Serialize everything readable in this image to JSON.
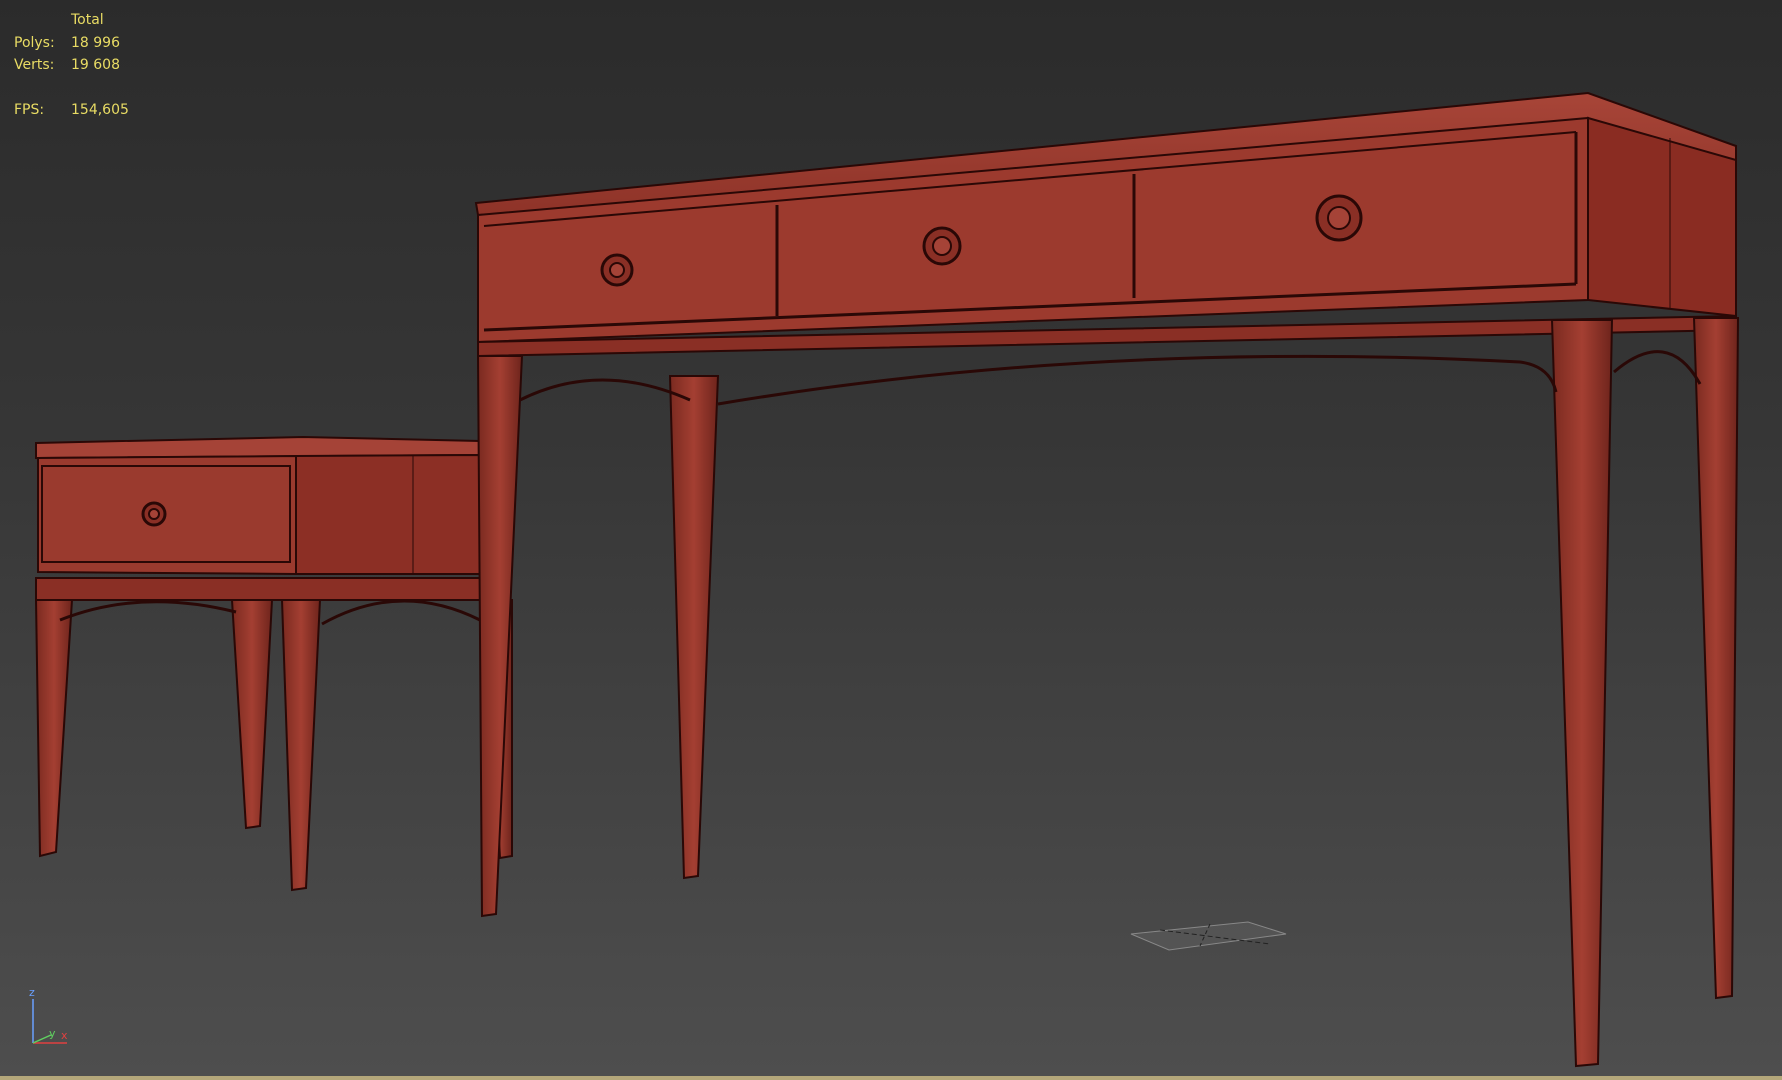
{
  "stats": {
    "header": "Total",
    "rows": [
      {
        "label": "Polys:",
        "value": "18 996"
      },
      {
        "label": "Verts:",
        "value": "19 608"
      }
    ],
    "fps": {
      "label": "FPS:",
      "value": "154,605"
    }
  },
  "axis": {
    "z": "z",
    "y": "y",
    "x": "x"
  },
  "colors": {
    "viewport_bg": "#3c3c3c",
    "stats_text": "#e9dc64",
    "furniture_fill": "#9c3a2e",
    "furniture_wire": "#2a0806",
    "axis_z": "#6aa0ff",
    "axis_y": "#60d060",
    "axis_x": "#e04040"
  }
}
